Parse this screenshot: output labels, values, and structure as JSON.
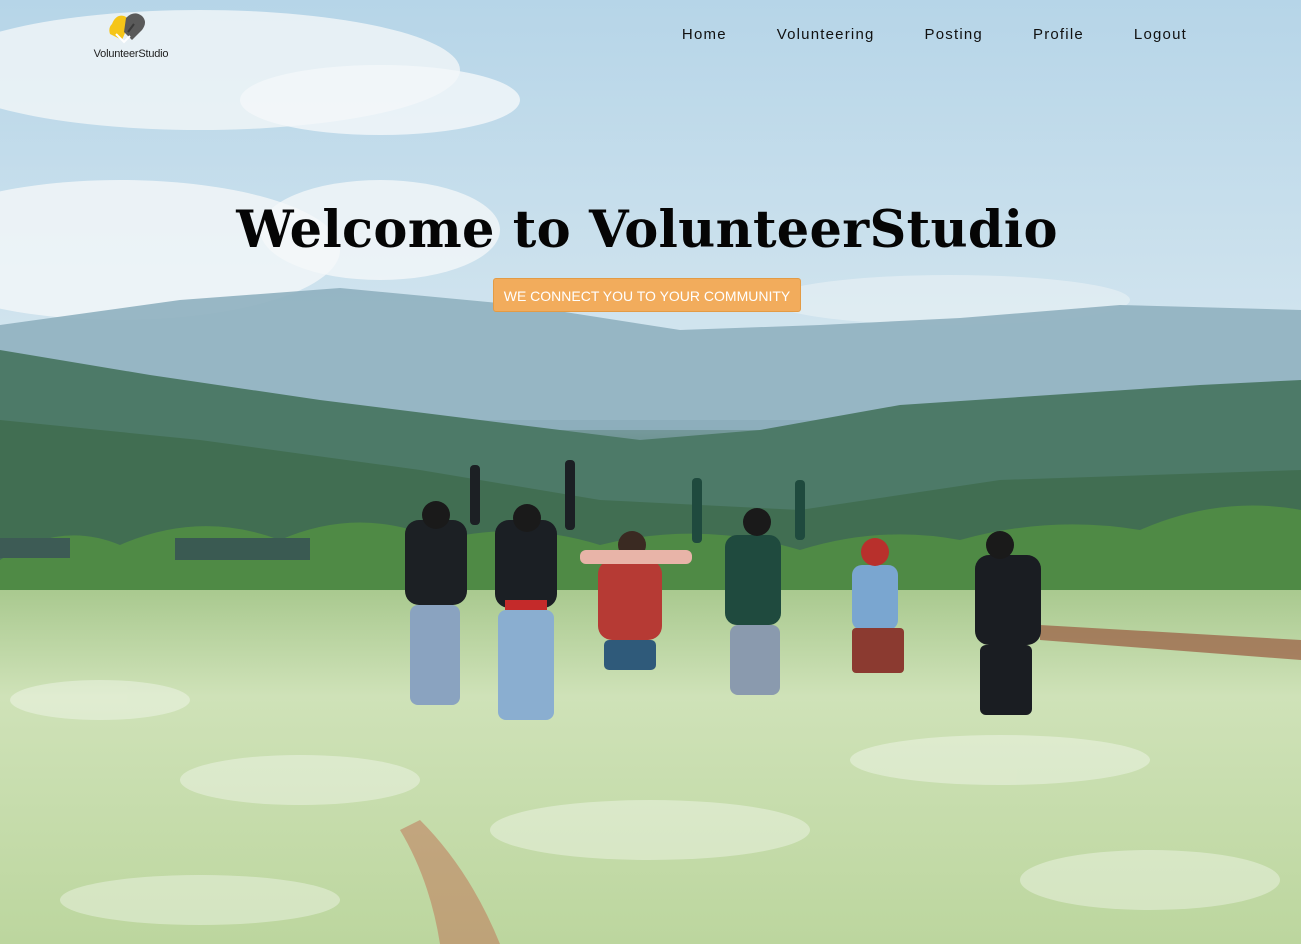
{
  "brand": {
    "name": "VolunteerStudio",
    "logo_icon": "handshake-heart-icon",
    "logo_colors": [
      "#f5c518",
      "#555555"
    ]
  },
  "nav": {
    "items": [
      {
        "label": "Home"
      },
      {
        "label": "Volunteering"
      },
      {
        "label": "Posting"
      },
      {
        "label": "Profile"
      },
      {
        "label": "Logout"
      }
    ]
  },
  "hero": {
    "title": "Welcome to VolunteerStudio",
    "tagline": "WE CONNECT YOU TO YOUR COMMUNITY",
    "tagline_color": "#f2ac5c",
    "background_image": "people-jumping-in-flower-field-photo"
  }
}
